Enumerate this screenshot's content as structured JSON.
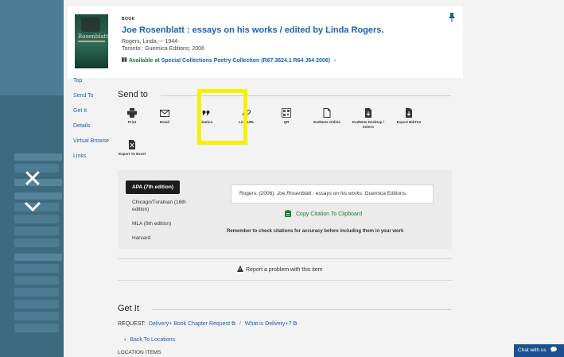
{
  "record": {
    "type_label": "BOOK",
    "title": "Joe Rosenblatt : essays on his works / edited by Linda Rogers.",
    "author": "Rogers, Linda,--- 1944-",
    "publisher": "Toronto : Guernica Editions; 2006",
    "availability_prefix": "Available at",
    "location": "Special Collections  Poetry Collection (R67.3624.1 R64 J64 2006)",
    "cover_title": "Rosenblatt"
  },
  "sidenav": [
    "Top",
    "Send To",
    "Get It",
    "Details",
    "Virtual Browse",
    "Links"
  ],
  "send_to": {
    "title": "Send to",
    "actions": [
      {
        "label": "Print",
        "icon": "printer-icon"
      },
      {
        "label": "Email",
        "icon": "envelope-icon"
      },
      {
        "label": "Citation",
        "icon": "quote-icon"
      },
      {
        "label": "Link/URL",
        "icon": "link-icon"
      },
      {
        "label": "QR",
        "icon": "qr-icon"
      },
      {
        "label": "EndNote Online",
        "icon": "document-icon"
      },
      {
        "label": "EndNote Desktop / Zotero",
        "icon": "file-download-icon"
      },
      {
        "label": "Export BibTeX",
        "icon": "file-download-icon"
      },
      {
        "label": "Export To Excel",
        "icon": "excel-icon"
      }
    ]
  },
  "citation": {
    "styles": [
      "APA (7th edition)",
      "Chicago/Turabian (16th edition)",
      "MLA (9th edition)",
      "Harvard"
    ],
    "active_style": "APA (7th edition)",
    "text_before": "Rogers. (2006). ",
    "text_italic": "Joe Rosenblatt : essays on his works",
    "text_after": ". Guernica Editions.",
    "copy_label": "Copy Citation To Clipboard",
    "note": "Remember to check citations for accuracy before including them in your work"
  },
  "report_label": "Report a problem with this item",
  "get_it": {
    "title": "Get It",
    "request_label": "REQUEST:",
    "request_link_1": "Delivery+ Book Chapter Request",
    "request_link_2": "What is Delivery+?",
    "back_label": "Back To Locations",
    "location_items_label": "LOCATION ITEMS"
  },
  "chat_label": "Chat with us",
  "colors": {
    "link": "#1862b4",
    "available": "#1a7f3a",
    "highlight": "#f7f100",
    "chat": "#1d4f91"
  }
}
